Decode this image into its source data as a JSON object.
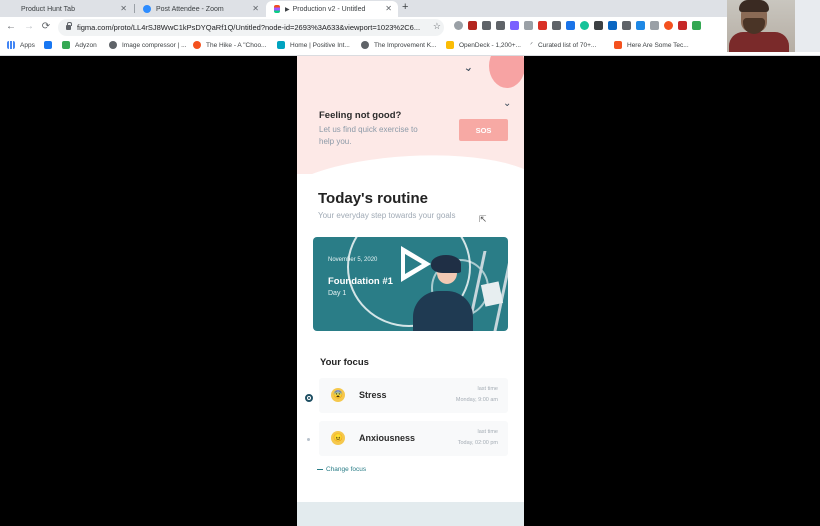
{
  "browser": {
    "tabs": [
      {
        "title": "Product Hunt Tab",
        "active": false
      },
      {
        "title": "Post Attendee - Zoom",
        "active": false
      },
      {
        "title": "Production v2 - Untitled",
        "active": true
      }
    ],
    "new_tab": "+",
    "back": "←",
    "forward": "→",
    "reload": "⟳",
    "star": "☆",
    "url": "figma.com/proto/LL4rSJ8WwC1kPsDYQaRf1Q/Untitled?node-id=2693%3A633&viewport=1023%2C6...",
    "bookmarks": [
      {
        "label": "Apps"
      },
      {
        "label": ""
      },
      {
        "label": "Adyzon"
      },
      {
        "label": "Image compressor | ..."
      },
      {
        "label": "The Hike - A \"Choo..."
      },
      {
        "label": "Home | Positive Int..."
      },
      {
        "label": "The Improvement K..."
      },
      {
        "label": "OpenDeck - 1,200+..."
      },
      {
        "label": "Curated list of 70+..."
      },
      {
        "label": "Here Are Some Tec..."
      }
    ]
  },
  "app": {
    "hero": {
      "title": "Feeling not good?",
      "subtitle": "Let us find quick exercise to help you.",
      "sos_label": "SOS"
    },
    "routine": {
      "title": "Today's routine",
      "subtitle": "Your everyday step towards your goals"
    },
    "video": {
      "date": "November 5, 2020",
      "title": "Foundation #1",
      "day": "Day 1"
    },
    "focus": {
      "title": "Your focus",
      "items": [
        {
          "emoji": "😨",
          "name": "Stress",
          "last_label": "last time",
          "when": "Monday, 9:00 am"
        },
        {
          "emoji": "😠",
          "name": "Anxiousness",
          "last_label": "last time",
          "when": "Today, 02:00 pm"
        }
      ],
      "change_label": "Change focus"
    }
  },
  "colors": {
    "accent_teal": "#2a7d87",
    "hero_bg": "#fde9e7",
    "sos": "#f7a9a4",
    "sun": "#f7a3a3"
  }
}
